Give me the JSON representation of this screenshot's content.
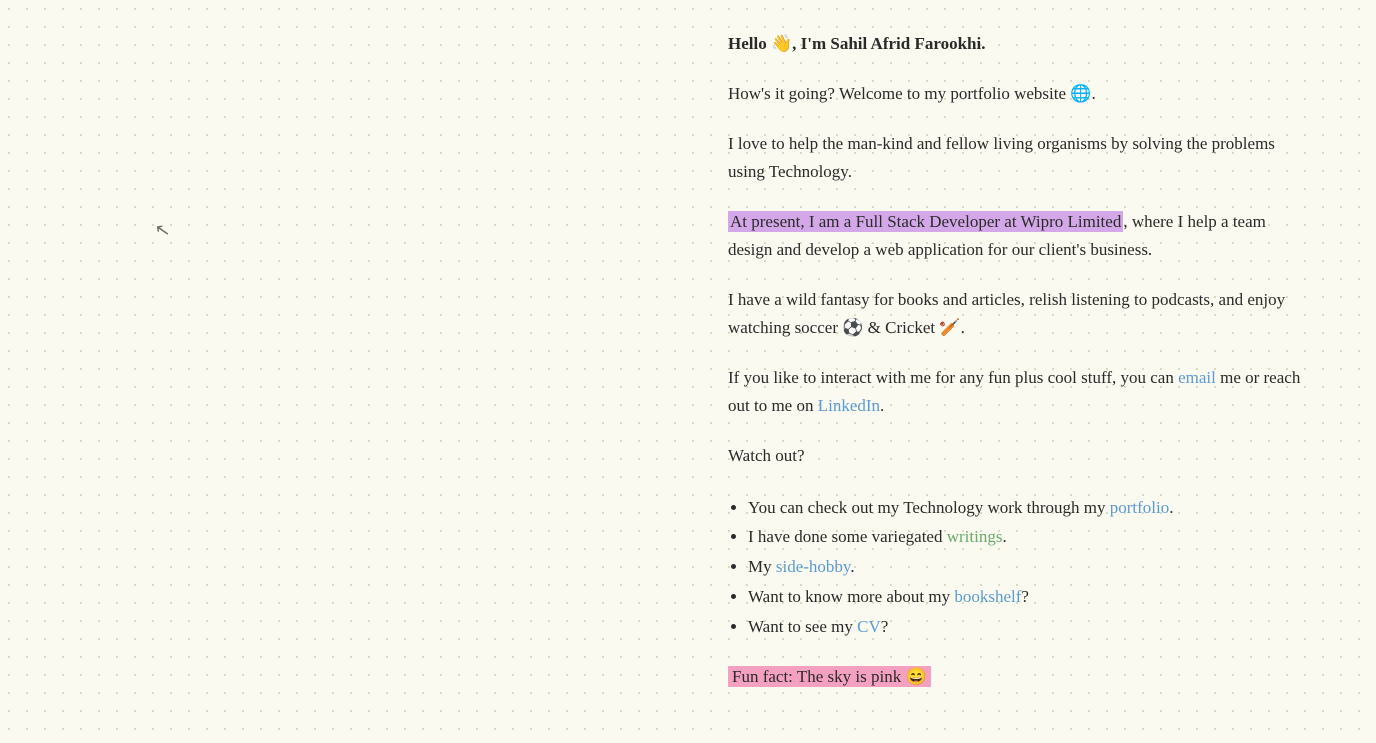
{
  "page": {
    "background": "#fafaf0",
    "cursor_visible": true
  },
  "content": {
    "greeting": "Hello 👋, I'm Sahil Afrid Farookhi.",
    "intro": "How's it going? Welcome to my portfolio website 🌐.",
    "mission": "I love to help the man-kind and fellow living organisms by solving the problems using Technology.",
    "current_role_pre": "At present, I am a Full Stack Developer at Wipro Limited",
    "current_role_post": ", where I help a team design and develop a web application for our client's business.",
    "hobbies_pre": "I have a wild fantasy for books and articles, relish listening to podcasts, and enjoy watching soccer ⚽ & Cricket 🏏.",
    "contact_pre": "If you like to interact with me for any fun plus cool stuff, you can ",
    "contact_email": "email",
    "contact_mid": " me or reach out to me on ",
    "contact_linkedin": "LinkedIn",
    "contact_post": ".",
    "watch_out": "Watch out?",
    "list_items": [
      {
        "pre": "You can check out my Technology work through my ",
        "link": "portfolio",
        "post": "."
      },
      {
        "pre": "I have done some variegated ",
        "link": "writings",
        "post": "."
      },
      {
        "pre": "My ",
        "link": "side-hobby",
        "post": "."
      },
      {
        "pre": "Want to know more about my ",
        "link": "bookshelf",
        "post": "?"
      },
      {
        "pre": "Want to see my ",
        "link": "CV",
        "post": "?"
      }
    ],
    "fun_fact": "Fun fact: The sky is pink 😄",
    "links": {
      "portfolio": "#",
      "writings": "#",
      "side_hobby": "#",
      "bookshelf": "#",
      "cv": "#",
      "email": "#",
      "linkedin": "#"
    }
  }
}
